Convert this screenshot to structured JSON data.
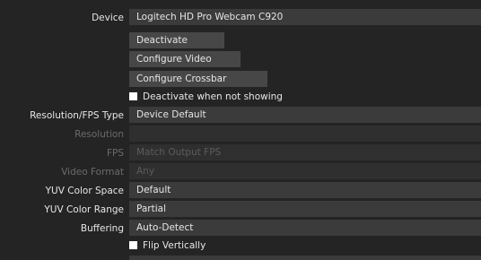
{
  "device": {
    "label": "Device",
    "value": "Logitech HD Pro Webcam C920"
  },
  "buttons": {
    "deactivate": "Deactivate",
    "configure_video": "Configure Video",
    "configure_crossbar": "Configure Crossbar"
  },
  "deactivate_when_not_showing": {
    "label": "Deactivate when not showing",
    "checked": false
  },
  "resolution_fps_type": {
    "label": "Resolution/FPS Type",
    "value": "Device Default"
  },
  "resolution": {
    "label": "Resolution",
    "value": ""
  },
  "fps": {
    "label": "FPS",
    "value": "Match Output FPS"
  },
  "video_format": {
    "label": "Video Format",
    "value": "Any"
  },
  "yuv_color_space": {
    "label": "YUV Color Space",
    "value": "Default"
  },
  "yuv_color_range": {
    "label": "YUV Color Range",
    "value": "Partial"
  },
  "buffering": {
    "label": "Buffering",
    "value": "Auto-Detect"
  },
  "flip_vertically": {
    "label": "Flip Vertically",
    "checked": false
  }
}
